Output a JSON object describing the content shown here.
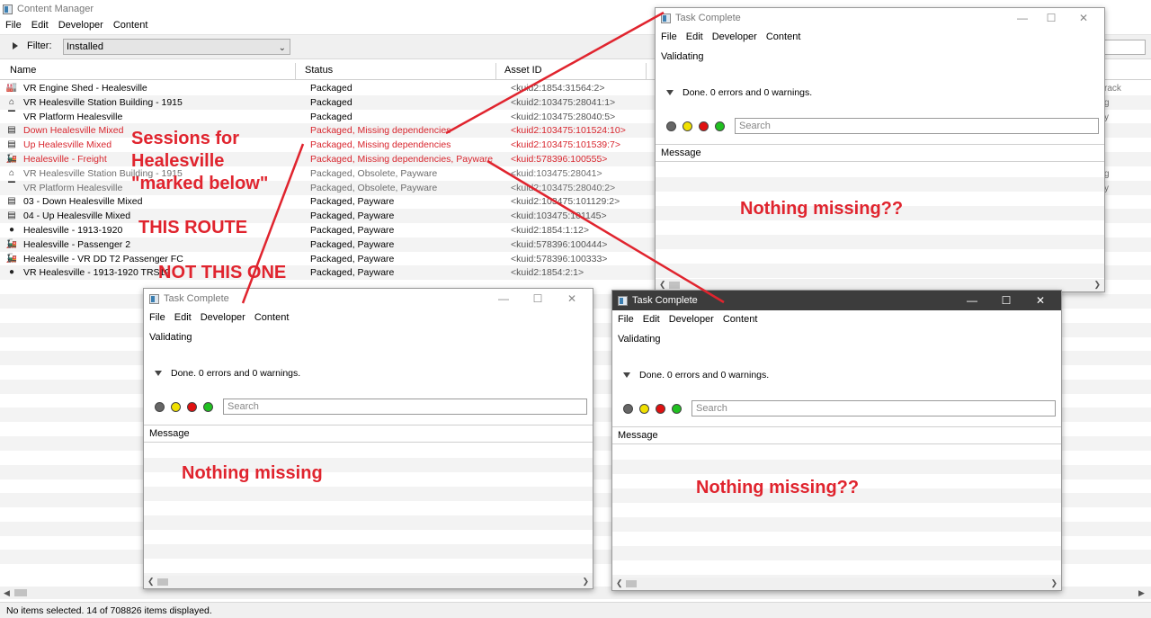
{
  "main": {
    "title": "Content Manager",
    "menu": [
      "File",
      "Edit",
      "Developer",
      "Content"
    ],
    "filter_label": "Filter:",
    "filter_value": "Installed",
    "columns": [
      "Name",
      "Status",
      "Asset ID"
    ],
    "rows": [
      {
        "icon": "engine-shed-icon",
        "name": "VR Engine Shed - Healesville",
        "status": "Packaged",
        "asset": "<kuid2:1854:31564:2>",
        "style": "normal"
      },
      {
        "icon": "station-building-icon",
        "name": "VR Healesville Station Building - 1915",
        "status": "Packaged",
        "asset": "<kuid2:103475:28041:1>",
        "style": "normal"
      },
      {
        "icon": "platform-icon",
        "name": "VR Platform Healesville",
        "status": "Packaged",
        "asset": "<kuid2:103475:28040:5>",
        "style": "normal"
      },
      {
        "icon": "session-icon",
        "name": "Down Healesville Mixed",
        "status": "Packaged, Missing dependencies",
        "asset": "<kuid2:103475:101524:10>",
        "style": "red"
      },
      {
        "icon": "session-icon",
        "name": "Up Healesville Mixed",
        "status": "Packaged, Missing dependencies",
        "asset": "<kuid2:103475:101539:7>",
        "style": "red"
      },
      {
        "icon": "train-icon",
        "name": "Healesville - Freight",
        "status": "Packaged, Missing dependencies, Payware",
        "asset": "<kuid:578396:100555>",
        "style": "red"
      },
      {
        "icon": "station-building-icon",
        "name": "VR Healesville Station Building - 1915",
        "status": "Packaged, Obsolete, Payware",
        "asset": "<kuid:103475:28041>",
        "style": "gray"
      },
      {
        "icon": "platform-icon",
        "name": "VR Platform Healesville",
        "status": "Packaged, Obsolete, Payware",
        "asset": "<kuid2:103475:28040:2>",
        "style": "gray"
      },
      {
        "icon": "session-icon",
        "name": "03 - Down Healesville Mixed",
        "status": "Packaged, Payware",
        "asset": "<kuid2:103475:101129:2>",
        "style": "normal"
      },
      {
        "icon": "session-icon",
        "name": "04 - Up Healesville Mixed",
        "status": "Packaged, Payware",
        "asset": "<kuid:103475:101145>",
        "style": "normal"
      },
      {
        "icon": "route-pin-icon",
        "name": "Healesville - 1913-1920",
        "status": "Packaged, Payware",
        "asset": "<kuid2:1854:1:12>",
        "style": "normal"
      },
      {
        "icon": "train-icon",
        "name": "Healesville - Passenger 2",
        "status": "Packaged, Payware",
        "asset": "<kuid:578396:100444>",
        "style": "normal"
      },
      {
        "icon": "train-icon",
        "name": "Healesville - VR DD T2 Passenger FC",
        "status": "Packaged, Payware",
        "asset": "<kuid:578396:100333>",
        "style": "normal"
      },
      {
        "icon": "route-pin-icon",
        "name": "VR Healesville - 1913-1920 TRS19",
        "status": "Packaged, Payware",
        "asset": "<kuid2:1854:2:1>",
        "style": "normal"
      }
    ],
    "right_fragments": [
      "rack",
      "g",
      "y",
      "g",
      "y"
    ],
    "status_bar": "No items selected. 14 of 708826 items displayed."
  },
  "dialogs": [
    {
      "title": "Task Complete",
      "menu": [
        "File",
        "Edit",
        "Developer",
        "Content"
      ],
      "validating": "Validating",
      "done": "Done. 0 errors and 0 warnings.",
      "search_placeholder": "Search",
      "message_header": "Message",
      "annotation": "Nothing missing??",
      "active": false
    },
    {
      "title": "Task Complete",
      "menu": [
        "File",
        "Edit",
        "Developer",
        "Content"
      ],
      "validating": "Validating",
      "done": "Done. 0 errors and 0 warnings.",
      "search_placeholder": "Search",
      "message_header": "Message",
      "annotation": "Nothing missing",
      "active": false
    },
    {
      "title": "Task Complete",
      "menu": [
        "File",
        "Edit",
        "Developer",
        "Content"
      ],
      "validating": "Validating",
      "done": "Done. 0 errors and 0 warnings.",
      "search_placeholder": "Search",
      "message_header": "Message",
      "annotation": "Nothing missing??",
      "active": true
    }
  ],
  "annotations": {
    "sessions_line1": "Sessions for",
    "sessions_line2": "Healesville",
    "sessions_line3": "\"marked below\"",
    "this_route": "THIS ROUTE",
    "not_this_one": "NOT THIS ONE"
  },
  "colors": {
    "missing_red": "#d8262e",
    "annotation_red": "#e0242e",
    "obsolete_gray": "#6d6d6d",
    "dot_gray": "#666666",
    "dot_yellow": "#f0e000",
    "dot_red": "#e01010",
    "dot_green": "#20c020"
  }
}
